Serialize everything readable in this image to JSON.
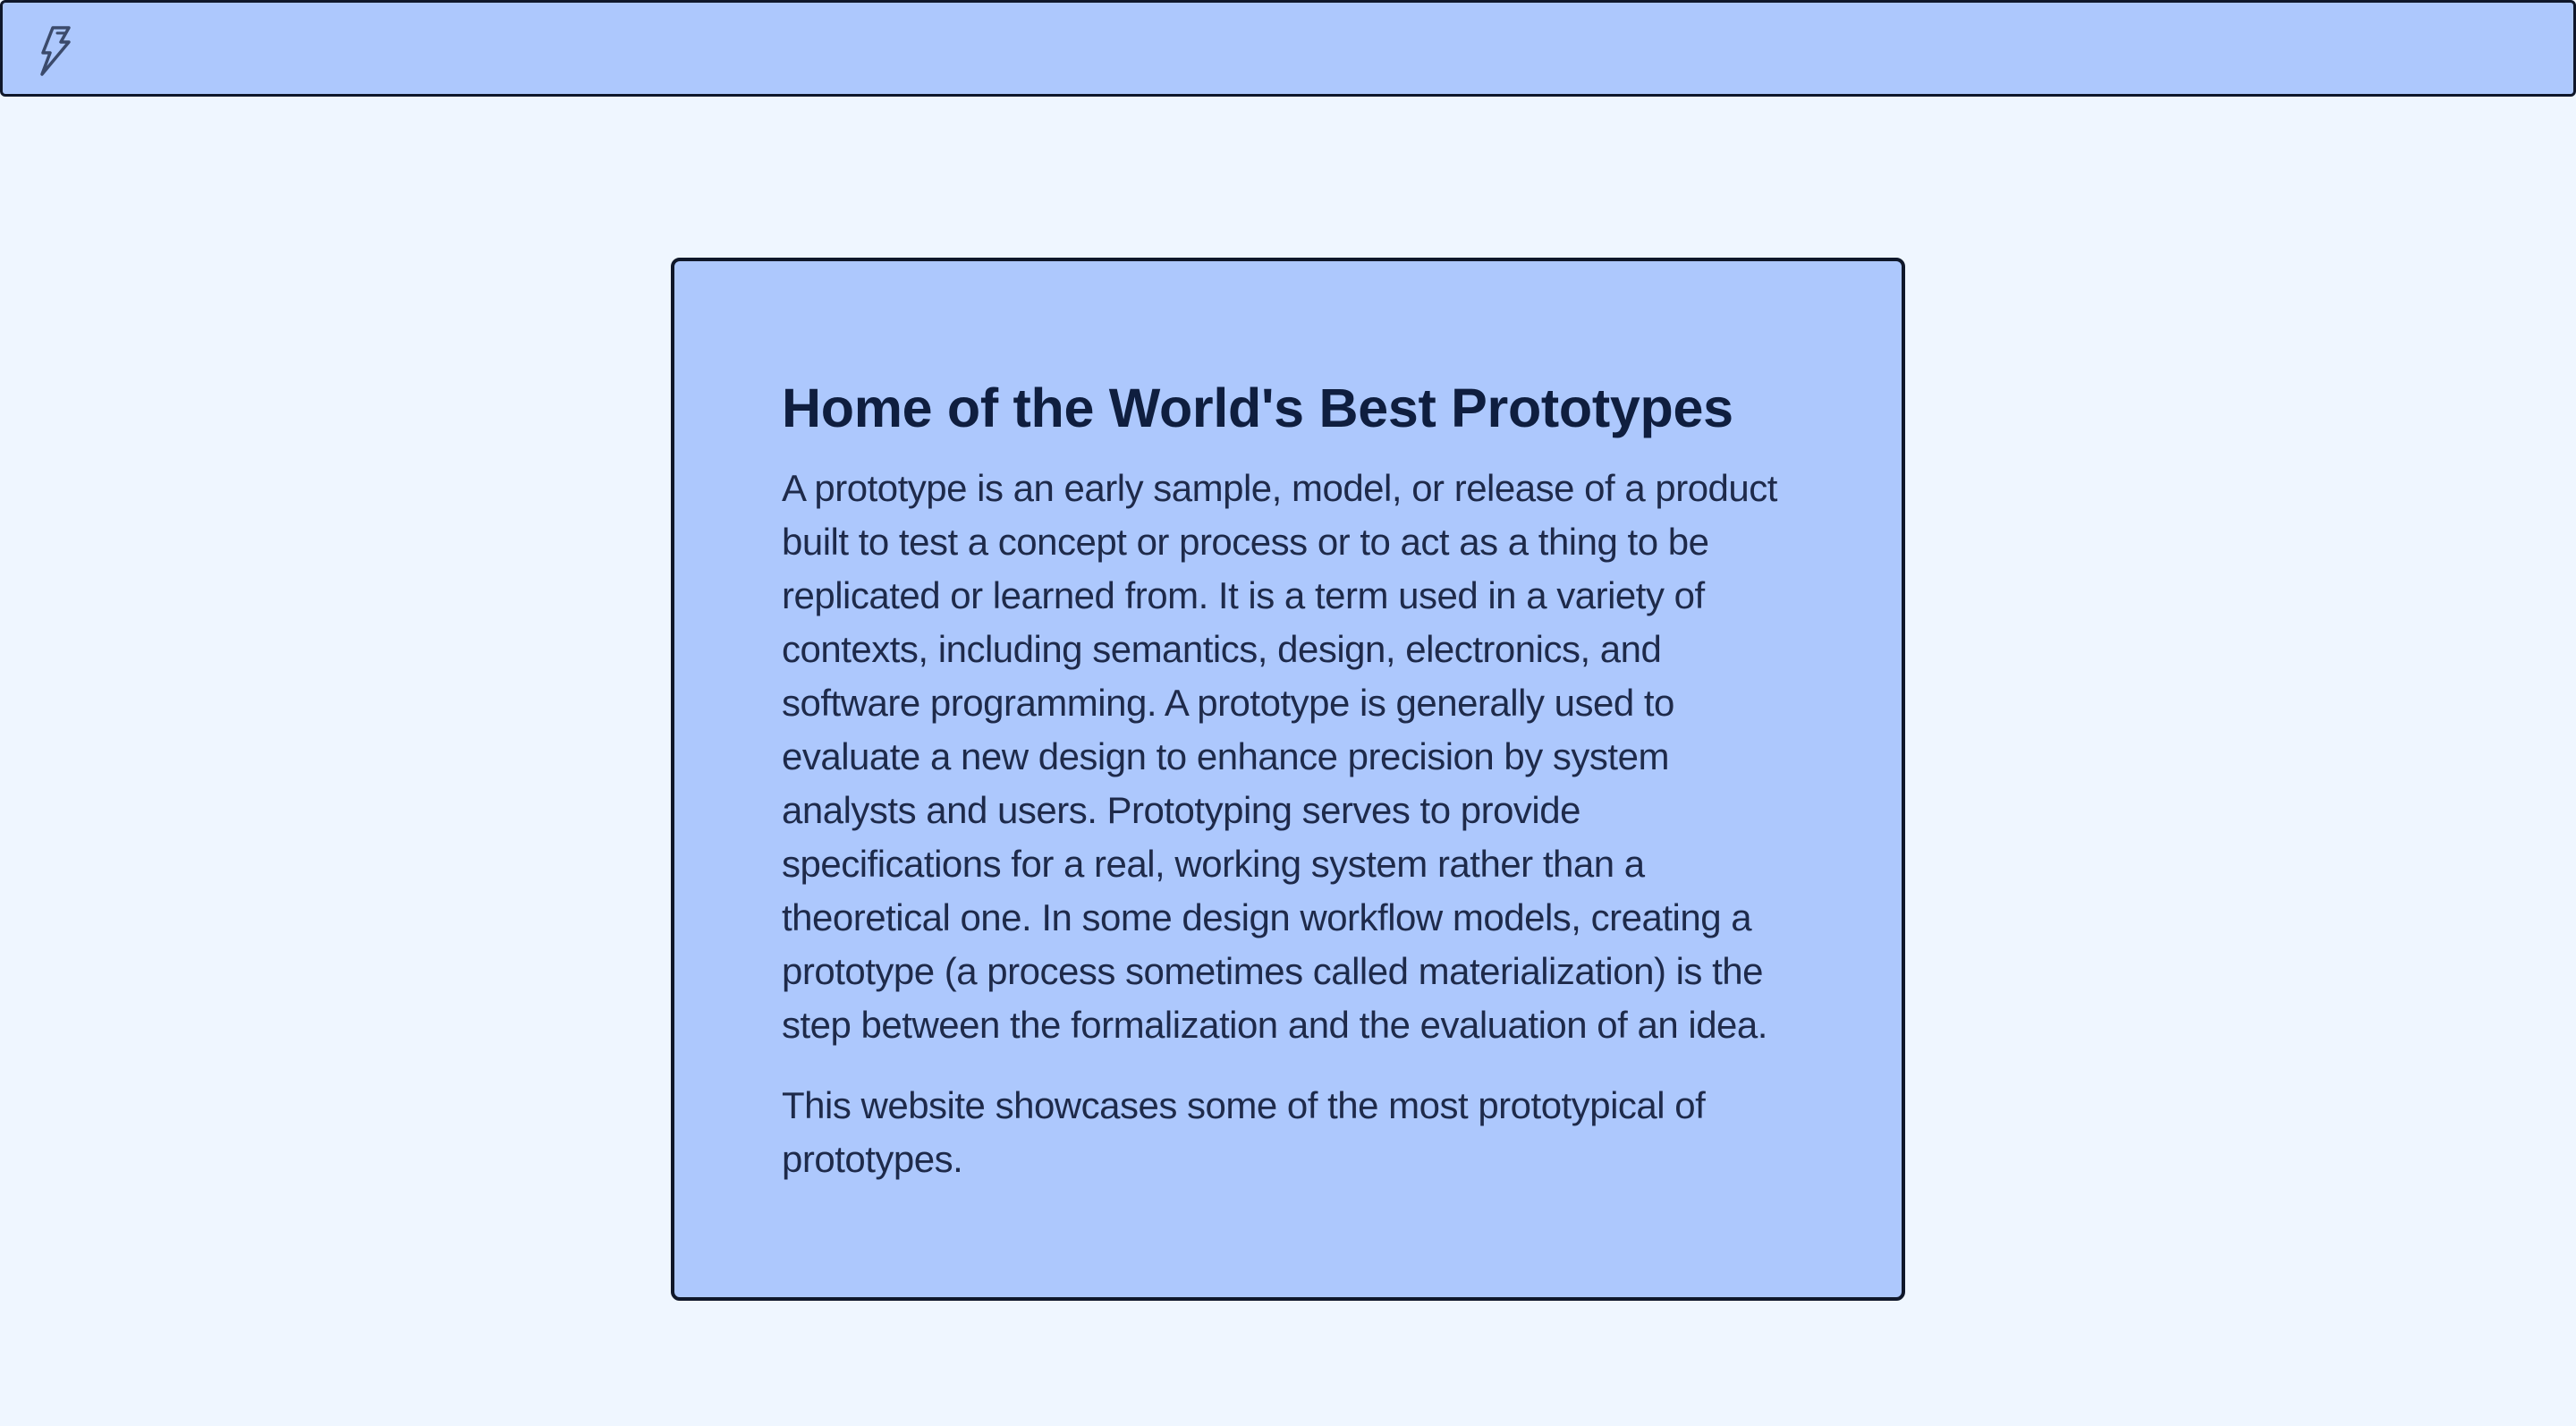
{
  "header": {
    "logo_icon": "lightning-bolt-icon"
  },
  "colors": {
    "page_background": "#eff6ff",
    "panel_background": "#adc8fd",
    "border": "#0f172a",
    "text": "#1e2a4a"
  },
  "hero": {
    "title": "Home of the World's Best Prototypes",
    "paragraphs": [
      "A prototype is an early sample, model, or release of a product built to test a concept or process or to act as a thing to be replicated or learned from. It is a term used in a variety of contexts, including semantics, design, electronics, and software programming. A prototype is generally used to evaluate a new design to enhance precision by system analysts and users. Prototyping serves to provide specifications for a real, working system rather than a theoretical one. In some design workflow models, creating a prototype (a process sometimes called materialization) is the step between the formalization and the evaluation of an idea.",
      "This website showcases some of the most prototypical of prototypes."
    ]
  }
}
